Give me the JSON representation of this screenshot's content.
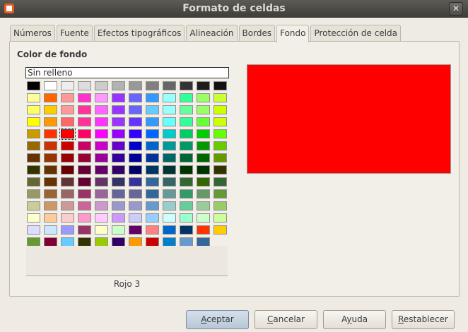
{
  "window": {
    "title": "Formato de celdas",
    "close_glyph": "✕"
  },
  "tabs": [
    {
      "label": "Números"
    },
    {
      "label": "Fuente"
    },
    {
      "label": "Efectos tipográficos"
    },
    {
      "label": "Alineación"
    },
    {
      "label": "Bordes"
    },
    {
      "label": "Fondo"
    },
    {
      "label": "Protección de celda"
    }
  ],
  "active_tab": "Fondo",
  "background": {
    "section_label": "Color de fondo",
    "no_fill_label": "Sin relleno",
    "selected_color_name": "Rojo 3",
    "preview_color": "#ff0000",
    "selected_row": 4,
    "selected_col": 2,
    "palette": [
      [
        "#000000",
        "#ffffff",
        "#eeeeee",
        "#dddddd",
        "#cccccc",
        "#b2b2b2",
        "#999999",
        "#808080",
        "#666666",
        "#333333",
        "#1c1c1c",
        "#111111"
      ],
      [
        "#ffff99",
        "#ff6600",
        "#ff9999",
        "#ff33cc",
        "#ff99ff",
        "#9933ff",
        "#6666ff",
        "#3399ff",
        "#99ffff",
        "#33ff99",
        "#99ff66",
        "#ccff33"
      ],
      [
        "#ffff66",
        "#ffcc00",
        "#ff9999",
        "#ff3399",
        "#ff66ff",
        "#9933ff",
        "#6666ff",
        "#66ccff",
        "#99ffff",
        "#66ff99",
        "#99ff66",
        "#ccff00"
      ],
      [
        "#ffff00",
        "#ff9900",
        "#ff6666",
        "#ff3399",
        "#ff33ff",
        "#9933ff",
        "#6633ff",
        "#3399ff",
        "#66ffff",
        "#33ff99",
        "#66ff33",
        "#ccff00"
      ],
      [
        "#cc9900",
        "#ff3300",
        "#ff0000",
        "#ff0066",
        "#ff00ff",
        "#9900ff",
        "#3300ff",
        "#0066ff",
        "#00cccc",
        "#00cc66",
        "#00cc00",
        "#66ff00"
      ],
      [
        "#996600",
        "#cc3300",
        "#cc0000",
        "#cc0066",
        "#cc00cc",
        "#6600cc",
        "#0000cc",
        "#0066cc",
        "#009999",
        "#009966",
        "#009900",
        "#66cc00"
      ],
      [
        "#663300",
        "#993300",
        "#990000",
        "#990033",
        "#990099",
        "#330099",
        "#000099",
        "#003399",
        "#006666",
        "#006633",
        "#006600",
        "#669900"
      ],
      [
        "#333300",
        "#663300",
        "#660000",
        "#660033",
        "#660066",
        "#330066",
        "#000066",
        "#003366",
        "#003333",
        "#003300",
        "#003300",
        "#333300"
      ],
      [
        "#666633",
        "#663300",
        "#663333",
        "#660033",
        "#663366",
        "#333366",
        "#333399",
        "#336699",
        "#336666",
        "#336633",
        "#336600",
        "#336633"
      ],
      [
        "#999966",
        "#996633",
        "#996666",
        "#993366",
        "#996699",
        "#666699",
        "#666699",
        "#336699",
        "#669999",
        "#339966",
        "#669966",
        "#669933"
      ],
      [
        "#cccc99",
        "#cc9966",
        "#cc9999",
        "#cc6699",
        "#cc99cc",
        "#9999cc",
        "#9999cc",
        "#6699cc",
        "#99cccc",
        "#66cc99",
        "#99cc99",
        "#99cc66"
      ],
      [
        "#ffffcc",
        "#ffcc99",
        "#ffcccc",
        "#ff99cc",
        "#ffccff",
        "#cc99ff",
        "#ccccff",
        "#99ccff",
        "#ccffff",
        "#99ffcc",
        "#ccffcc",
        "#ccff99"
      ],
      [
        "#ddddff",
        "#cce6ff",
        "#9999ff",
        "#993366",
        "#ffffcc",
        "#ccffcc",
        "#660066",
        "#ff8080",
        "#0066cc",
        "#003366",
        "#ff3300",
        "#ffcc00"
      ],
      [
        "#669933",
        "#800033",
        "#66ccff",
        "#333300",
        "#99cc00",
        "#330066",
        "#ff9900",
        "#cc0000",
        "#0080cc",
        "#6699cc",
        "#336699"
      ]
    ]
  },
  "buttons": {
    "ok": {
      "pre": "",
      "u": "A",
      "post": "ceptar"
    },
    "cancel": {
      "pre": "",
      "u": "C",
      "post": "ancelar"
    },
    "help": {
      "pre": "A",
      "u": "y",
      "post": "uda"
    },
    "reset": {
      "pre": "",
      "u": "R",
      "post": "establecer"
    }
  }
}
